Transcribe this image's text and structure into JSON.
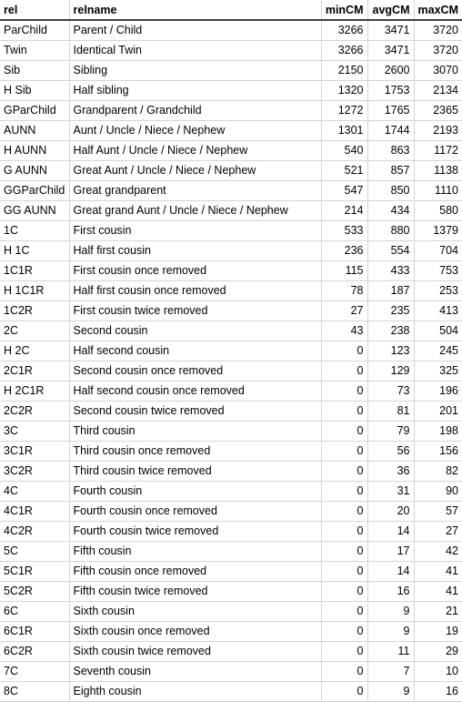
{
  "table": {
    "columns": [
      {
        "key": "rel",
        "label": "rel",
        "align": "left"
      },
      {
        "key": "relname",
        "label": "relname",
        "align": "left"
      },
      {
        "key": "minCM",
        "label": "minCM",
        "align": "right"
      },
      {
        "key": "avgCM",
        "label": "avgCM",
        "align": "right"
      },
      {
        "key": "maxCM",
        "label": "maxCM",
        "align": "right"
      }
    ],
    "rows": [
      {
        "rel": "ParChild",
        "relname": "Parent / Child",
        "minCM": "3266",
        "avgCM": "3471",
        "maxCM": "3720"
      },
      {
        "rel": "Twin",
        "relname": "Identical Twin",
        "minCM": "3266",
        "avgCM": "3471",
        "maxCM": "3720"
      },
      {
        "rel": "Sib",
        "relname": "Sibling",
        "minCM": "2150",
        "avgCM": "2600",
        "maxCM": "3070"
      },
      {
        "rel": "H Sib",
        "relname": "Half sibling",
        "minCM": "1320",
        "avgCM": "1753",
        "maxCM": "2134"
      },
      {
        "rel": "GParChild",
        "relname": "Grandparent / Grandchild",
        "minCM": "1272",
        "avgCM": "1765",
        "maxCM": "2365"
      },
      {
        "rel": "AUNN",
        "relname": "Aunt / Uncle / Niece / Nephew",
        "minCM": "1301",
        "avgCM": "1744",
        "maxCM": "2193"
      },
      {
        "rel": "H AUNN",
        "relname": "Half Aunt / Uncle / Niece / Nephew",
        "minCM": "540",
        "avgCM": "863",
        "maxCM": "1172"
      },
      {
        "rel": "G AUNN",
        "relname": "Great Aunt / Uncle / Niece / Nephew",
        "minCM": "521",
        "avgCM": "857",
        "maxCM": "1138"
      },
      {
        "rel": "GGParChild",
        "relname": "Great grandparent",
        "minCM": "547",
        "avgCM": "850",
        "maxCM": "1110"
      },
      {
        "rel": "GG AUNN",
        "relname": "Great grand Aunt / Uncle / Niece / Nephew",
        "minCM": "214",
        "avgCM": "434",
        "maxCM": "580"
      },
      {
        "rel": "1C",
        "relname": "First cousin",
        "minCM": "533",
        "avgCM": "880",
        "maxCM": "1379"
      },
      {
        "rel": "H 1C",
        "relname": "Half first cousin",
        "minCM": "236",
        "avgCM": "554",
        "maxCM": "704"
      },
      {
        "rel": "1C1R",
        "relname": "First cousin once removed",
        "minCM": "115",
        "avgCM": "433",
        "maxCM": "753"
      },
      {
        "rel": "H 1C1R",
        "relname": "Half first cousin once removed",
        "minCM": "78",
        "avgCM": "187",
        "maxCM": "253"
      },
      {
        "rel": "1C2R",
        "relname": "First cousin twice removed",
        "minCM": "27",
        "avgCM": "235",
        "maxCM": "413"
      },
      {
        "rel": "2C",
        "relname": "Second cousin",
        "minCM": "43",
        "avgCM": "238",
        "maxCM": "504"
      },
      {
        "rel": "H 2C",
        "relname": "Half second cousin",
        "minCM": "0",
        "avgCM": "123",
        "maxCM": "245"
      },
      {
        "rel": "2C1R",
        "relname": "Second cousin once removed",
        "minCM": "0",
        "avgCM": "129",
        "maxCM": "325"
      },
      {
        "rel": "H 2C1R",
        "relname": "Half second cousin once removed",
        "minCM": "0",
        "avgCM": "73",
        "maxCM": "196"
      },
      {
        "rel": "2C2R",
        "relname": "Second cousin twice removed",
        "minCM": "0",
        "avgCM": "81",
        "maxCM": "201"
      },
      {
        "rel": "3C",
        "relname": "Third cousin",
        "minCM": "0",
        "avgCM": "79",
        "maxCM": "198"
      },
      {
        "rel": "3C1R",
        "relname": "Third cousin once removed",
        "minCM": "0",
        "avgCM": "56",
        "maxCM": "156"
      },
      {
        "rel": "3C2R",
        "relname": "Third cousin twice removed",
        "minCM": "0",
        "avgCM": "36",
        "maxCM": "82"
      },
      {
        "rel": "4C",
        "relname": "Fourth cousin",
        "minCM": "0",
        "avgCM": "31",
        "maxCM": "90"
      },
      {
        "rel": "4C1R",
        "relname": "Fourth cousin once removed",
        "minCM": "0",
        "avgCM": "20",
        "maxCM": "57"
      },
      {
        "rel": "4C2R",
        "relname": "Fourth cousin twice removed",
        "minCM": "0",
        "avgCM": "14",
        "maxCM": "27"
      },
      {
        "rel": "5C",
        "relname": "Fifth cousin",
        "minCM": "0",
        "avgCM": "17",
        "maxCM": "42"
      },
      {
        "rel": "5C1R",
        "relname": "Fifth cousin once removed",
        "minCM": "0",
        "avgCM": "14",
        "maxCM": "41"
      },
      {
        "rel": "5C2R",
        "relname": "Fifth cousin twice removed",
        "minCM": "0",
        "avgCM": "16",
        "maxCM": "41"
      },
      {
        "rel": "6C",
        "relname": "Sixth cousin",
        "minCM": "0",
        "avgCM": "9",
        "maxCM": "21"
      },
      {
        "rel": "6C1R",
        "relname": "Sixth cousin once removed",
        "minCM": "0",
        "avgCM": "9",
        "maxCM": "19"
      },
      {
        "rel": "6C2R",
        "relname": "Sixth cousin twice removed",
        "minCM": "0",
        "avgCM": "11",
        "maxCM": "29"
      },
      {
        "rel": "7C",
        "relname": "Seventh cousin",
        "minCM": "0",
        "avgCM": "7",
        "maxCM": "10"
      },
      {
        "rel": "8C",
        "relname": "Eighth cousin",
        "minCM": "0",
        "avgCM": "9",
        "maxCM": "16"
      }
    ]
  },
  "chart_data": {
    "type": "table",
    "title": "",
    "columns": [
      "rel",
      "relname",
      "minCM",
      "avgCM",
      "maxCM"
    ],
    "rows": [
      [
        "ParChild",
        "Parent / Child",
        3266,
        3471,
        3720
      ],
      [
        "Twin",
        "Identical Twin",
        3266,
        3471,
        3720
      ],
      [
        "Sib",
        "Sibling",
        2150,
        2600,
        3070
      ],
      [
        "H Sib",
        "Half sibling",
        1320,
        1753,
        2134
      ],
      [
        "GParChild",
        "Grandparent / Grandchild",
        1272,
        1765,
        2365
      ],
      [
        "AUNN",
        "Aunt / Uncle / Niece / Nephew",
        1301,
        1744,
        2193
      ],
      [
        "H AUNN",
        "Half Aunt / Uncle / Niece / Nephew",
        540,
        863,
        1172
      ],
      [
        "G AUNN",
        "Great Aunt / Uncle / Niece / Nephew",
        521,
        857,
        1138
      ],
      [
        "GGParChild",
        "Great grandparent",
        547,
        850,
        1110
      ],
      [
        "GG AUNN",
        "Great grand Aunt / Uncle / Niece / Nephew",
        214,
        434,
        580
      ],
      [
        "1C",
        "First cousin",
        533,
        880,
        1379
      ],
      [
        "H 1C",
        "Half first cousin",
        236,
        554,
        704
      ],
      [
        "1C1R",
        "First cousin once removed",
        115,
        433,
        753
      ],
      [
        "H 1C1R",
        "Half first cousin once removed",
        78,
        187,
        253
      ],
      [
        "1C2R",
        "First cousin twice removed",
        27,
        235,
        413
      ],
      [
        "2C",
        "Second cousin",
        43,
        238,
        504
      ],
      [
        "H 2C",
        "Half second cousin",
        0,
        123,
        245
      ],
      [
        "2C1R",
        "Second cousin once removed",
        0,
        129,
        325
      ],
      [
        "H 2C1R",
        "Half second cousin once removed",
        0,
        73,
        196
      ],
      [
        "2C2R",
        "Second cousin twice removed",
        0,
        81,
        201
      ],
      [
        "3C",
        "Third cousin",
        0,
        79,
        198
      ],
      [
        "3C1R",
        "Third cousin once removed",
        0,
        56,
        156
      ],
      [
        "3C2R",
        "Third cousin twice removed",
        0,
        36,
        82
      ],
      [
        "4C",
        "Fourth cousin",
        0,
        31,
        90
      ],
      [
        "4C1R",
        "Fourth cousin once removed",
        0,
        20,
        57
      ],
      [
        "4C2R",
        "Fourth cousin twice removed",
        0,
        14,
        27
      ],
      [
        "5C",
        "Fifth cousin",
        0,
        17,
        42
      ],
      [
        "5C1R",
        "Fifth cousin once removed",
        0,
        14,
        41
      ],
      [
        "5C2R",
        "Fifth cousin twice removed",
        0,
        16,
        41
      ],
      [
        "6C",
        "Sixth cousin",
        0,
        9,
        21
      ],
      [
        "6C1R",
        "Sixth cousin once removed",
        0,
        9,
        19
      ],
      [
        "6C2R",
        "Sixth cousin twice removed",
        0,
        11,
        29
      ],
      [
        "7C",
        "Seventh cousin",
        0,
        7,
        10
      ],
      [
        "8C",
        "Eighth cousin",
        0,
        9,
        16
      ]
    ]
  },
  "colors": {
    "grid": "#d4d4d4",
    "header_rule": "#404040",
    "text": "#000000",
    "background": "#ffffff"
  }
}
